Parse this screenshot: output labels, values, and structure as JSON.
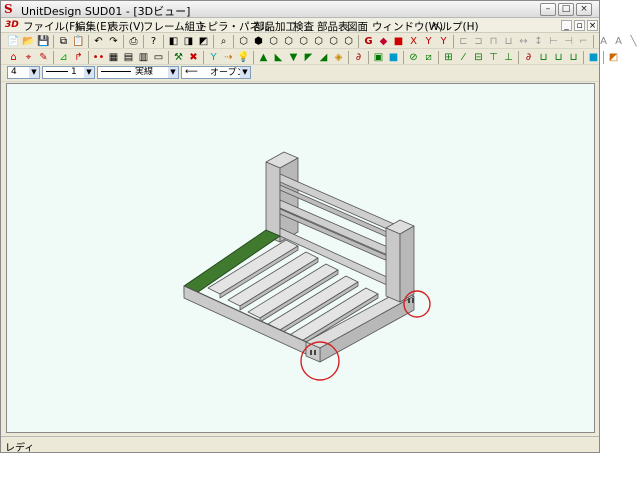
{
  "window": {
    "title": "UnitDesign SUD01 - [3Dビュー]",
    "logo_text": "S",
    "minimize_icon": "minimize-icon",
    "maximize_icon": "maximize-icon",
    "close_icon": "close-icon"
  },
  "menubar": {
    "mode_badge": "3D",
    "items": [
      {
        "label": "ファイル(F)"
      },
      {
        "label": "編集(E)"
      },
      {
        "label": "表示(V)"
      },
      {
        "label": "フレーム組立"
      },
      {
        "label": "トピラ・パネル"
      },
      {
        "label": "部品加工"
      },
      {
        "label": "検査"
      },
      {
        "label": "部品表"
      },
      {
        "label": "図面"
      },
      {
        "label": "ウィンドウ(W)"
      },
      {
        "label": "ヘルプ(H)"
      }
    ]
  },
  "options_bar": {
    "layer_value": "4",
    "line_width_value": "1",
    "line_style_value": "実線",
    "arrow_style_value": "オープン"
  },
  "statusbar": {
    "text": "レディ"
  },
  "colors": {
    "frame_face": "#c4c4c4",
    "frame_top": "#dedede",
    "highlight_bar": "#3f7a2e",
    "callout": "#d42020",
    "viewport_bg": "#f0fbf8"
  }
}
